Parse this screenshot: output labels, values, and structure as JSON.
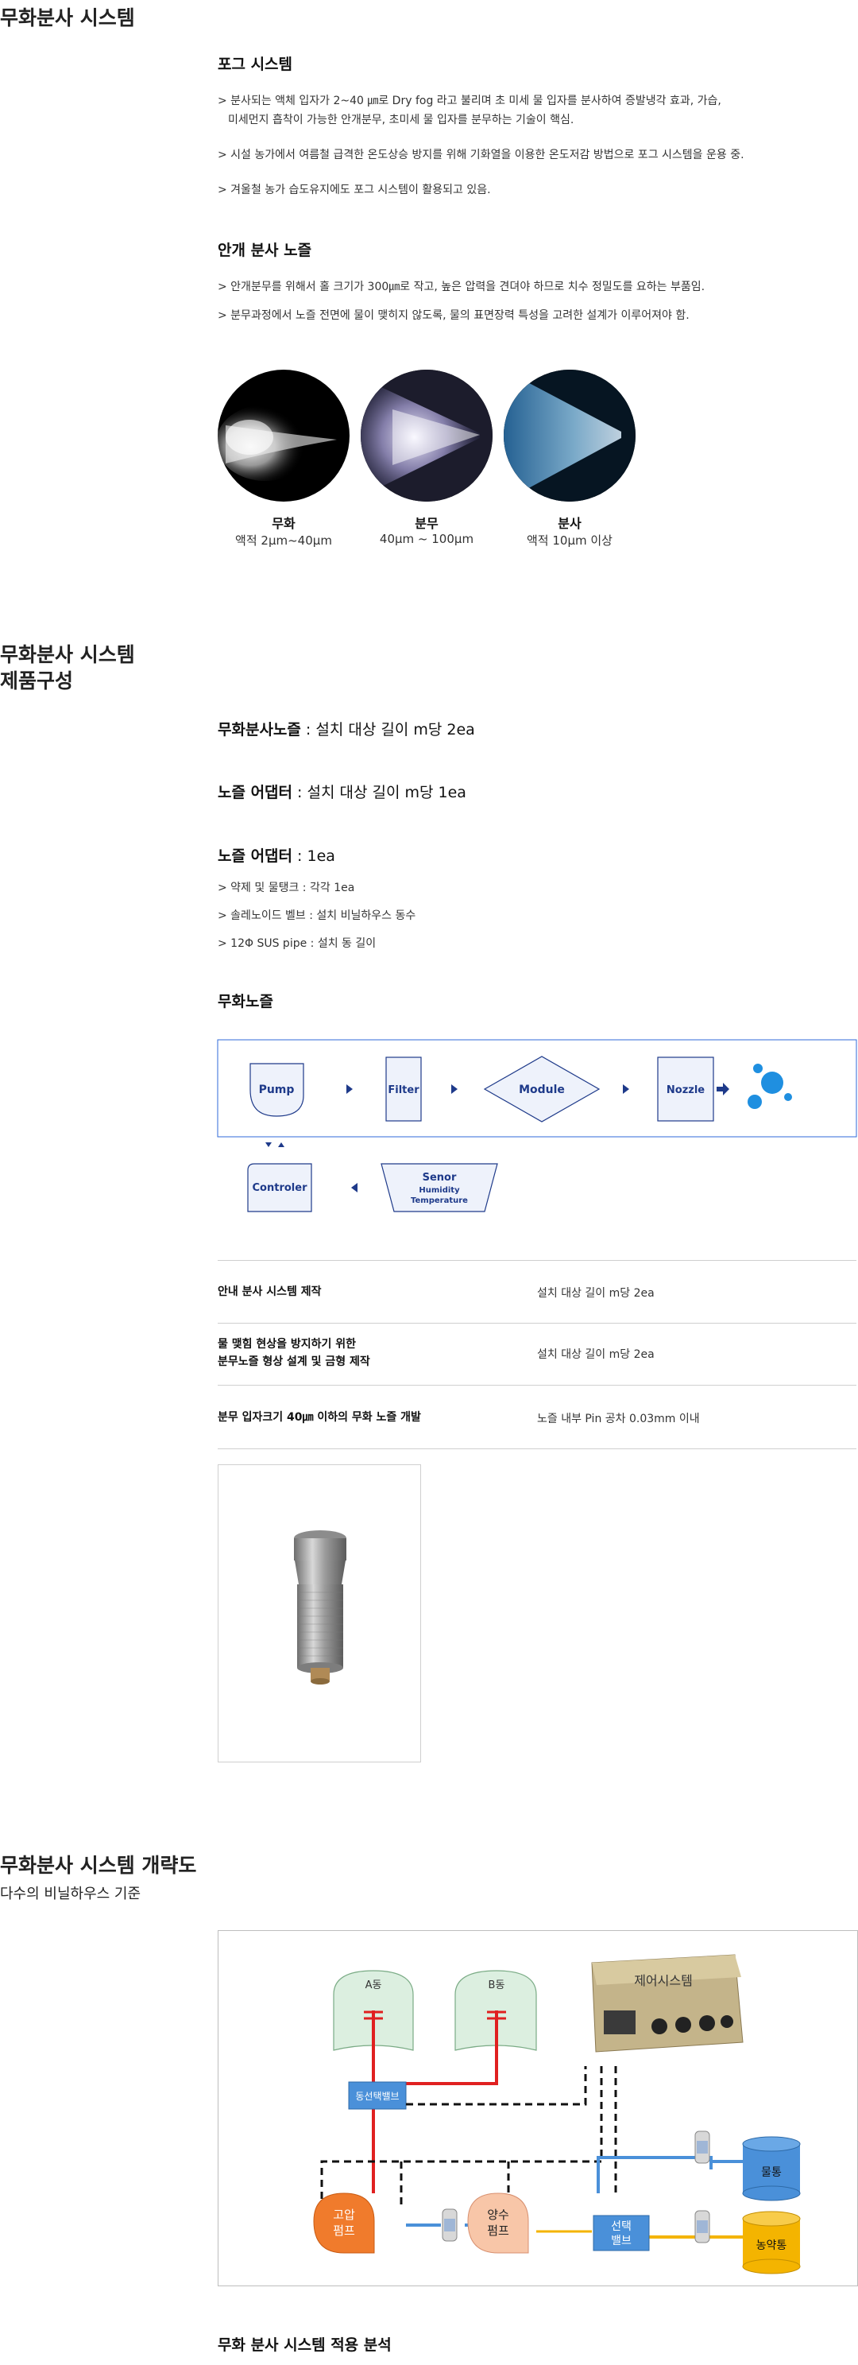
{
  "s1": {
    "title": "무화분사 시스템",
    "fog_heading": "포그 시스템",
    "fog_b1_l1": "> 분사되는 액체 입자가 2~40 ㎛로 Dry fog 라고 불리며 초 미세 물 입자를 분사하여 증발냉각 효과, 가습,",
    "fog_b1_l2": "미세먼지 흡착이 가능한 안개분무, 초미세 물 입자를 분무하는 기술이 핵심.",
    "fog_b2": "> 시설 농가에서 여름철 급격한 온도상승 방지를 위해 기화열을 이용한 온도저감 방법으로 포그 시스템을 운용 중.",
    "fog_b3": "> 겨울철 농가 습도유지에도 포그 시스템이 활용되고 있음.",
    "nozzle_heading": "안개 분사 노즐",
    "nozzle_b1": "> 안개분무를 위해서 홀 크기가 300㎛로 작고, 높은 압력을 견뎌야 하므로 치수 정밀도를 요하는 부품임.",
    "nozzle_b2": "> 분무과정에서 노즐 전면에 물이 맺히지 않도록, 물의 표면장력 특성을 고려한 설계가 이루어져야 함.",
    "sprays": [
      {
        "title": "무화",
        "size": "액적 2μm~40μm"
      },
      {
        "title": "분무",
        "size": "40μm ~ 100μm"
      },
      {
        "title": "분사",
        "size": "액적 10μm 이상"
      }
    ]
  },
  "s2": {
    "title_l1": "무화분사 시스템",
    "title_l2": "제품구성",
    "spec1_b": "무화분사노즐",
    "spec1_r": " : 설치 대상 길이 m당 2ea",
    "spec2_b": "노즐 어댑터",
    "spec2_r": " : 설치 대상 길이 m당 1ea",
    "spec3_b": "노즐 어댑터",
    "spec3_r": " : 1ea",
    "item1": "> 약제 및 물탱크 : 각각 1ea",
    "item2": "> 솔레노이드 벨브 : 설치 비닐하우스 동수",
    "item3": "> 12Φ SUS pipe : 설치 동 길이",
    "flow_heading": "무화노즐",
    "flow": {
      "pump": "Pump",
      "filter": "Filter",
      "module": "Module",
      "nozzle": "Nozzle",
      "controller": "Controler",
      "sensor": "Senor",
      "sensor_sub1": "Humidity",
      "sensor_sub2": "Temperature"
    },
    "table": [
      {
        "l1": "안내 분사 시스템 제작",
        "l2": "",
        "r": "설치 대상 길이 m당 2ea"
      },
      {
        "l1": "물 맺힘 현상을 방지하기 위한",
        "l2": "분무노즐 형상 설계 및 금형 제작",
        "r": "설치 대상 길이 m당 2ea"
      },
      {
        "l1": "분무 입자크기 40㎛ 이하의 무화 노즐 개발",
        "l2": "",
        "r": "노즐 내부 Pin 공차 0.03mm 이내"
      }
    ]
  },
  "s3": {
    "title": "무화분사 시스템 개략도",
    "subtitle": "다수의 비닐하우스 기준",
    "diagram": {
      "house_a": "A동",
      "house_b": "B동",
      "control_system": "제어시스템",
      "zone_valve": "동선택밸브",
      "hp_pump_l1": "고압",
      "hp_pump_l2": "펌프",
      "ym_pump_l1": "양수",
      "ym_pump_l2": "펌프",
      "select_valve_l1": "선택",
      "select_valve_l2": "밸브",
      "water_tank": "물통",
      "chem_tank": "농약통"
    }
  },
  "s4": {
    "heading": "무화 분사 시스템 적용 분석"
  },
  "colors": {
    "accent_blue": "#2f6ad9",
    "navy": "#1e3a8a",
    "pipe_red": "#e02020",
    "pipe_yellow": "#f4b400",
    "pipe_blue": "#4a90d9"
  }
}
